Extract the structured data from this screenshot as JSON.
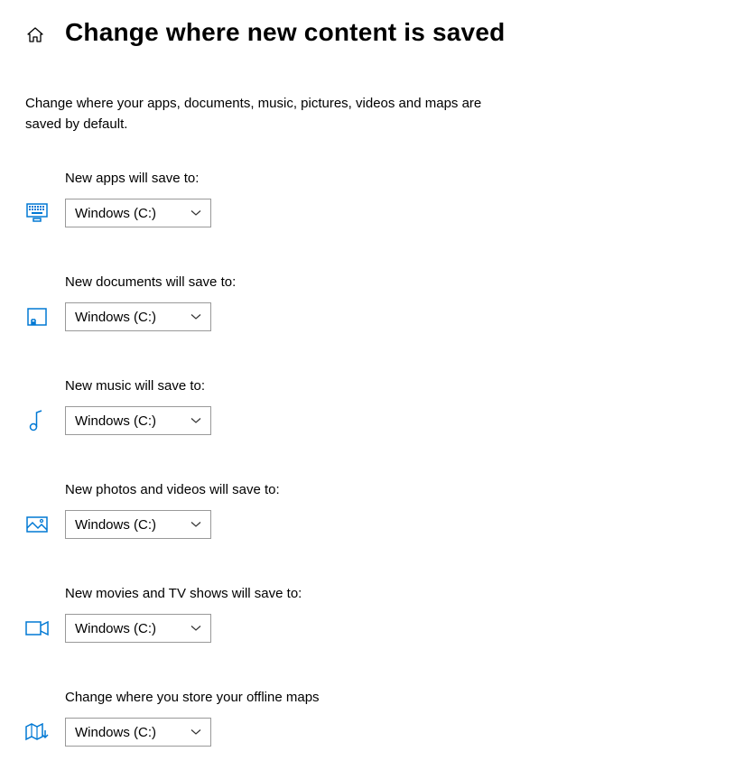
{
  "page": {
    "title": "Change where new content is saved",
    "description": "Change where your apps, documents, music, pictures, videos and maps are saved by default."
  },
  "settings": {
    "apps": {
      "label": "New apps will save to:",
      "value": "Windows (C:)"
    },
    "documents": {
      "label": "New documents will save to:",
      "value": "Windows (C:)"
    },
    "music": {
      "label": "New music will save to:",
      "value": "Windows (C:)"
    },
    "photos": {
      "label": "New photos and videos will save to:",
      "value": "Windows (C:)"
    },
    "movies": {
      "label": "New movies and TV shows will save to:",
      "value": "Windows (C:)"
    },
    "maps": {
      "label": "Change where you store your offline maps",
      "value": "Windows (C:)"
    }
  },
  "colors": {
    "accent": "#0078D4",
    "border": "#999999"
  }
}
